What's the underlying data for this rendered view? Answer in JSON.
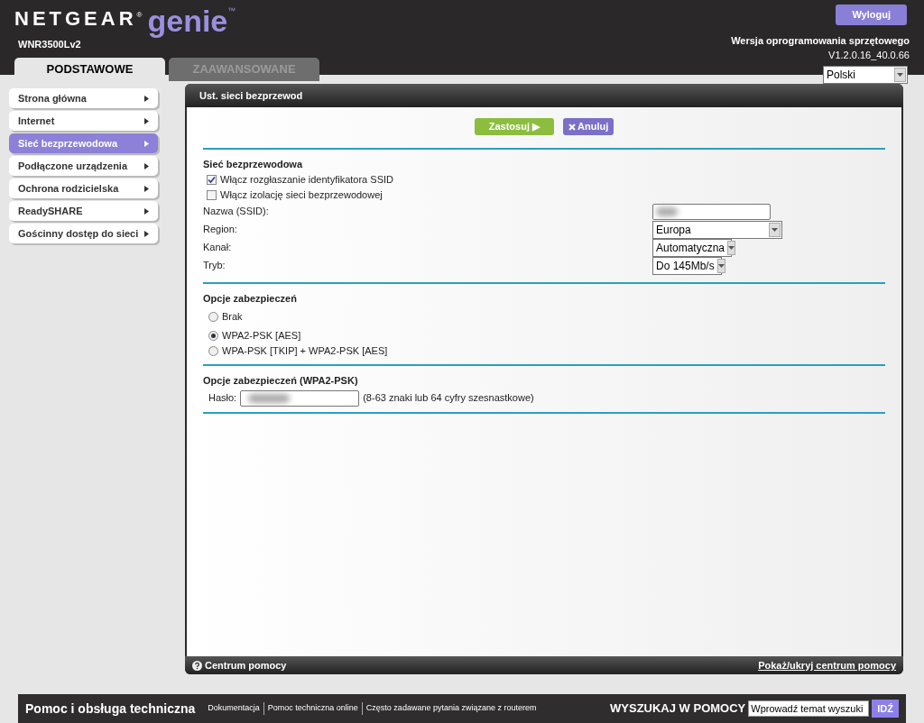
{
  "header": {
    "logo": {
      "brand": "NETGEAR",
      "brand_mark": "®",
      "product": "genie",
      "product_mark": "™"
    },
    "model": "WNR3500Lv2",
    "logout": "Wyloguj",
    "firmware_label": "Wersja oprogramowania sprzętowego",
    "firmware_version": "V1.2.0.16_40.0.66",
    "language": "Polski"
  },
  "tabs": [
    {
      "label": "PODSTAWOWE",
      "selected": true
    },
    {
      "label": "ZAAWANSOWANE",
      "selected": false
    }
  ],
  "sidebar": {
    "items": [
      {
        "label": "Strona główna",
        "selected": false
      },
      {
        "label": "Internet",
        "selected": false
      },
      {
        "label": "Sieć bezprzewodowa",
        "selected": true
      },
      {
        "label": "Podłączone urządzenia",
        "selected": false
      },
      {
        "label": "Ochrona rodzicielska",
        "selected": false
      },
      {
        "label": "ReadySHARE",
        "selected": false
      },
      {
        "label": "Gościnny dostęp do sieci",
        "selected": false
      }
    ]
  },
  "panel": {
    "title": "Ust. sieci bezprzewod",
    "apply": "Zastosuj ▶",
    "cancel": "Anuluj",
    "wireless": {
      "heading": "Sieć bezprzewodowa",
      "checkboxes": [
        {
          "label": "Włącz rozgłaszanie identyfikatora SSID",
          "checked": true
        },
        {
          "label": "Włącz izolację sieci bezprzewodowej",
          "checked": false
        }
      ],
      "fields": [
        {
          "kind": "text",
          "label": "Nazwa (SSID):",
          "blurred": true
        },
        {
          "kind": "select",
          "label": "Region:",
          "value": "Europa"
        },
        {
          "kind": "select",
          "label": "Kanał:",
          "value": "Automatyczna"
        },
        {
          "kind": "select",
          "label": "Tryb:",
          "value": "Do 145Mb/s"
        }
      ]
    },
    "security": {
      "heading": "Opcje zabezpieczeń",
      "options": [
        {
          "label": "Brak",
          "selected": false
        },
        {
          "label": "WPA2-PSK [AES]",
          "selected": true
        },
        {
          "label": "WPA-PSK [TKIP] + WPA2-PSK [AES]",
          "selected": false
        }
      ]
    },
    "psk": {
      "heading": "Opcje zabezpieczeń (WPA2-PSK)",
      "label": "Hasło:",
      "blurred": true,
      "hint": "(8-63 znaki lub 64 cyfry szesnastkowe)"
    },
    "help_center": "Centrum pomocy",
    "toggle_help": "Pokaż/ukryj centrum pomocy"
  },
  "footer": {
    "title": "Pomoc i obsługa techniczna",
    "links": [
      "Dokumentacja",
      "Pomoc techniczna online",
      "Często zadawane pytania związane z routerem"
    ],
    "search_label": "WYSZUKAJ W POMOCY",
    "search_value": "Wprowadź temat wyszuki",
    "go": "IDŹ"
  }
}
